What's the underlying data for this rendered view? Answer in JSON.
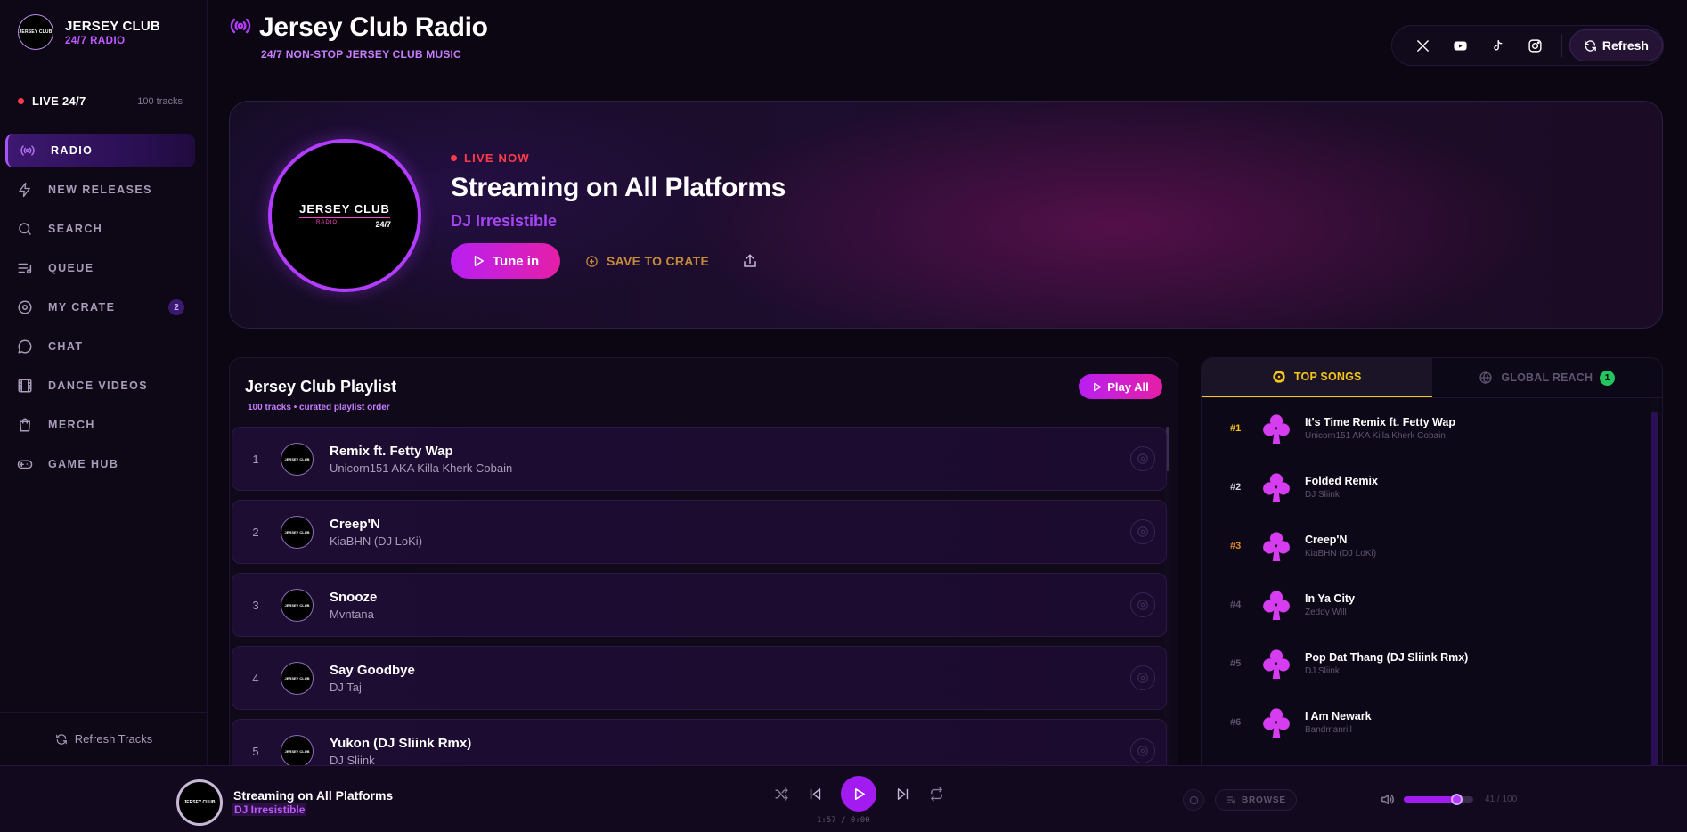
{
  "brand": {
    "logo_text": "JERSEY CLUB",
    "title": "JERSEY CLUB",
    "subtitle": "24/7 RADIO"
  },
  "sidebar": {
    "live_label": "LIVE 24/7",
    "track_count": "100 tracks",
    "items": [
      {
        "label": "RADIO",
        "icon": "radio-icon",
        "active": true
      },
      {
        "label": "NEW RELEASES",
        "icon": "lightning-icon"
      },
      {
        "label": "SEARCH",
        "icon": "search-icon"
      },
      {
        "label": "QUEUE",
        "icon": "queue-icon"
      },
      {
        "label": "MY CRATE",
        "icon": "disc-icon",
        "badge": "2"
      },
      {
        "label": "CHAT",
        "icon": "chat-icon"
      },
      {
        "label": "DANCE VIDEOS",
        "icon": "film-icon"
      },
      {
        "label": "MERCH",
        "icon": "shopping-bag-icon"
      },
      {
        "label": "GAME HUB",
        "icon": "gamepad-icon"
      }
    ],
    "footer_label": "Refresh Tracks"
  },
  "header": {
    "title": "Jersey Club Radio",
    "subtitle": "24/7 NON-STOP JERSEY CLUB MUSIC",
    "socials": [
      "x-icon",
      "youtube-icon",
      "tiktok-icon",
      "instagram-icon"
    ],
    "refresh_label": "Refresh"
  },
  "hero": {
    "disc_title": "JERSEY CLUB",
    "disc_sub": "RADIO",
    "disc_tag": "24/7",
    "live_label": "LIVE NOW",
    "title": "Streaming on All Platforms",
    "artist": "DJ Irresistible",
    "tune_in_label": "Tune in",
    "save_label": "SAVE TO CRATE"
  },
  "playlist": {
    "title": "Jersey Club Playlist",
    "subtitle": "100 tracks • curated playlist order",
    "play_all_label": "Play All",
    "art_text": "JERSEY CLUB",
    "tracks": [
      {
        "num": "1",
        "title": "Remix ft. Fetty Wap",
        "artist": "Unicorn151 AKA Killa Kherk Cobain"
      },
      {
        "num": "2",
        "title": "Creep'N",
        "artist": "KiaBHN (DJ LoKi)"
      },
      {
        "num": "3",
        "title": "Snooze",
        "artist": "Mvntana"
      },
      {
        "num": "4",
        "title": "Say Goodbye",
        "artist": "DJ Taj"
      },
      {
        "num": "5",
        "title": "Yukon (DJ Sliink Rmx)",
        "artist": "DJ Sliink"
      }
    ]
  },
  "top_panel": {
    "tab_top": "TOP SONGS",
    "tab_reach": "GLOBAL REACH",
    "reach_badge": "1",
    "songs": [
      {
        "rank": "#1",
        "title": "It's Time Remix ft. Fetty Wap",
        "artist": "Unicorn151 AKA Killa Kherk Cobain",
        "color": "#f5c518"
      },
      {
        "rank": "#2",
        "title": "Folded Remix",
        "artist": "DJ Sliink",
        "color": "#d1d5db"
      },
      {
        "rank": "#3",
        "title": "Creep'N",
        "artist": "KiaBHN (DJ LoKi)",
        "color": "#e58a2a"
      },
      {
        "rank": "#4",
        "title": "In Ya City",
        "artist": "Zeddy Will",
        "color": "#5f5470"
      },
      {
        "rank": "#5",
        "title": "Pop Dat Thang (DJ Sliink Rmx)",
        "artist": "DJ Sliink",
        "color": "#5f5470"
      },
      {
        "rank": "#6",
        "title": "I Am Newark",
        "artist": "Bandmanrill",
        "color": "#5f5470"
      }
    ]
  },
  "player": {
    "art_text": "JERSEY CLUB",
    "title": "Streaming on All Platforms",
    "artist": "DJ Irresistible",
    "time": "1:57 / 0:00",
    "browse_label": "BROWSE",
    "volume": 0.75,
    "count": "41 / 100"
  },
  "colors": {
    "accent": "#a21cf2",
    "pink": "#e51fa7",
    "gold": "#f5c518",
    "live": "#ff3b4b"
  }
}
